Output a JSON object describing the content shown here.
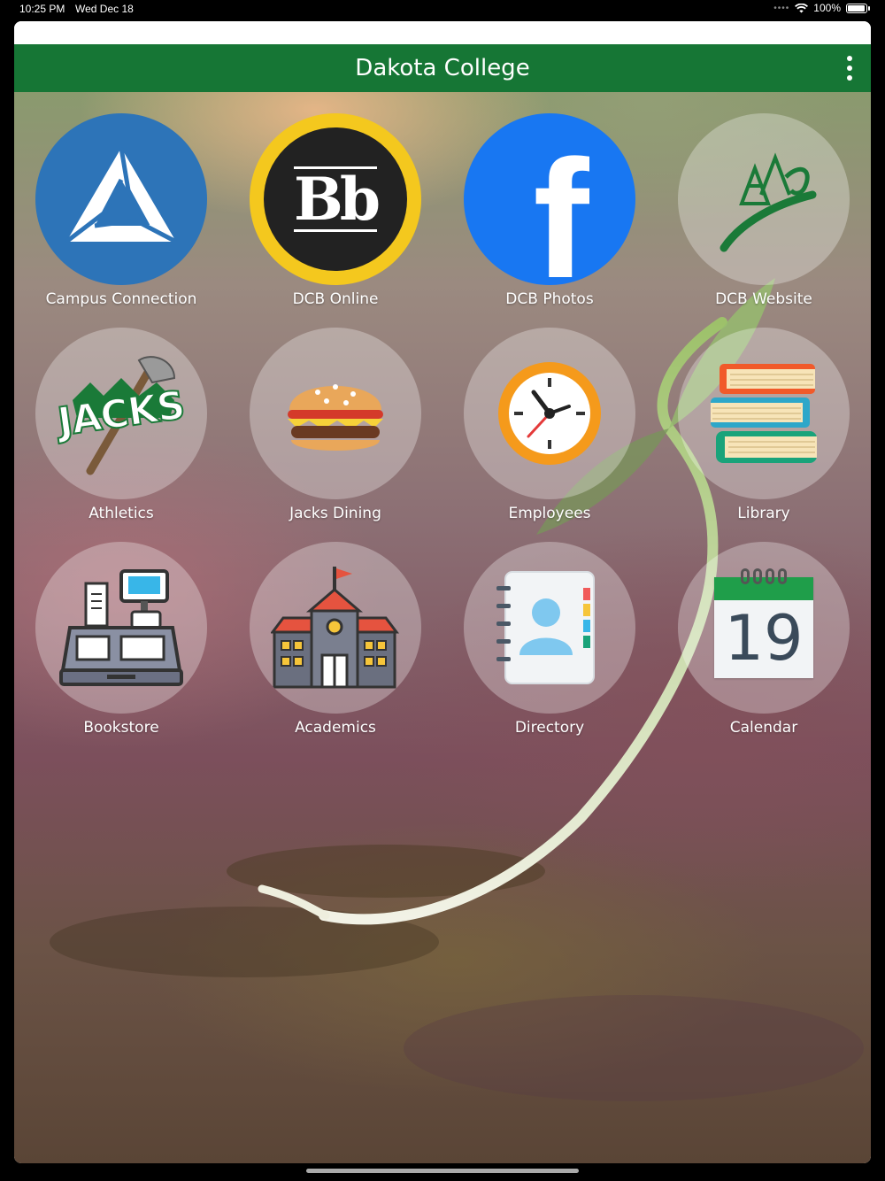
{
  "status_bar": {
    "time": "10:25 PM",
    "date": "Wed Dec 18",
    "battery_text": "100%",
    "battery_level": 1.0
  },
  "nav": {
    "title": "Dakota College",
    "menu_icon": "more-vertical-icon",
    "color": "#167635"
  },
  "tiles": [
    {
      "label": "Campus Connection",
      "icon": "campus-connection-logo"
    },
    {
      "label": "DCB Online",
      "icon": "blackboard-logo",
      "icon_text": "Bb"
    },
    {
      "label": "DCB Photos",
      "icon": "facebook-logo",
      "icon_text": "f"
    },
    {
      "label": "DCB Website",
      "icon": "dakota-college-logo"
    },
    {
      "label": "Athletics",
      "icon": "jacks-logo",
      "icon_text": "JACKS"
    },
    {
      "label": "Jacks Dining",
      "icon": "burger-icon"
    },
    {
      "label": "Employees",
      "icon": "clock-icon"
    },
    {
      "label": "Library",
      "icon": "books-icon"
    },
    {
      "label": "Bookstore",
      "icon": "cash-register-icon"
    },
    {
      "label": "Academics",
      "icon": "school-building-icon"
    },
    {
      "label": "Directory",
      "icon": "address-book-icon"
    },
    {
      "label": "Calendar",
      "icon": "calendar-icon",
      "icon_text": "19"
    }
  ]
}
